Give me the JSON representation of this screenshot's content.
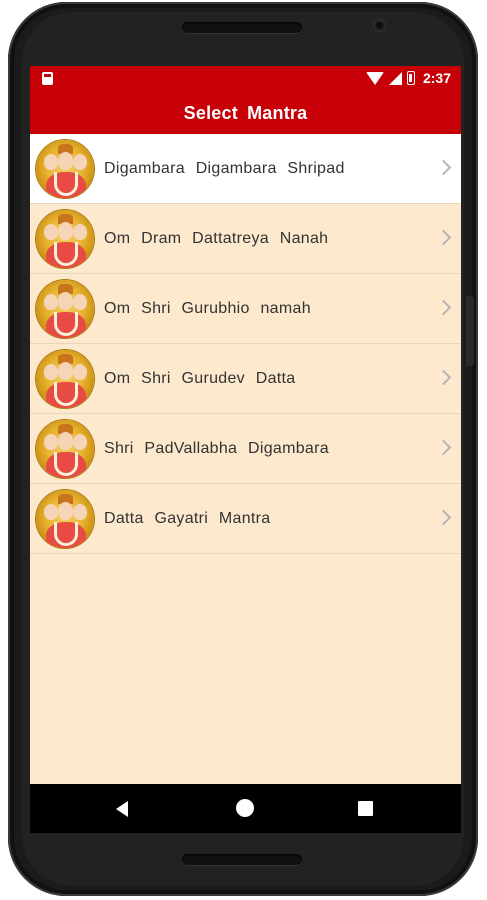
{
  "status_bar": {
    "time": "2:37",
    "icons": [
      "sd-card-icon",
      "wifi-icon",
      "signal-icon",
      "battery-icon"
    ]
  },
  "toolbar": {
    "title": "Select  Mantra"
  },
  "mantras": [
    {
      "label": "Digambara  Digambara  Shripad",
      "selected": true
    },
    {
      "label": "Om  Dram  Dattatreya  Nanah",
      "selected": false
    },
    {
      "label": "Om  Shri  Gurubhio  namah",
      "selected": false
    },
    {
      "label": "Om  Shri  Gurudev  Datta",
      "selected": false
    },
    {
      "label": "Shri  PadVallabha  Digambara",
      "selected": false
    },
    {
      "label": "Datta  Gayatri  Mantra",
      "selected": false
    }
  ],
  "colors": {
    "accent": "#c70008",
    "list_background": "#fde9cd",
    "selected_row": "#ffffff"
  },
  "navigation": [
    "back-icon",
    "home-icon",
    "recent-apps-icon"
  ]
}
